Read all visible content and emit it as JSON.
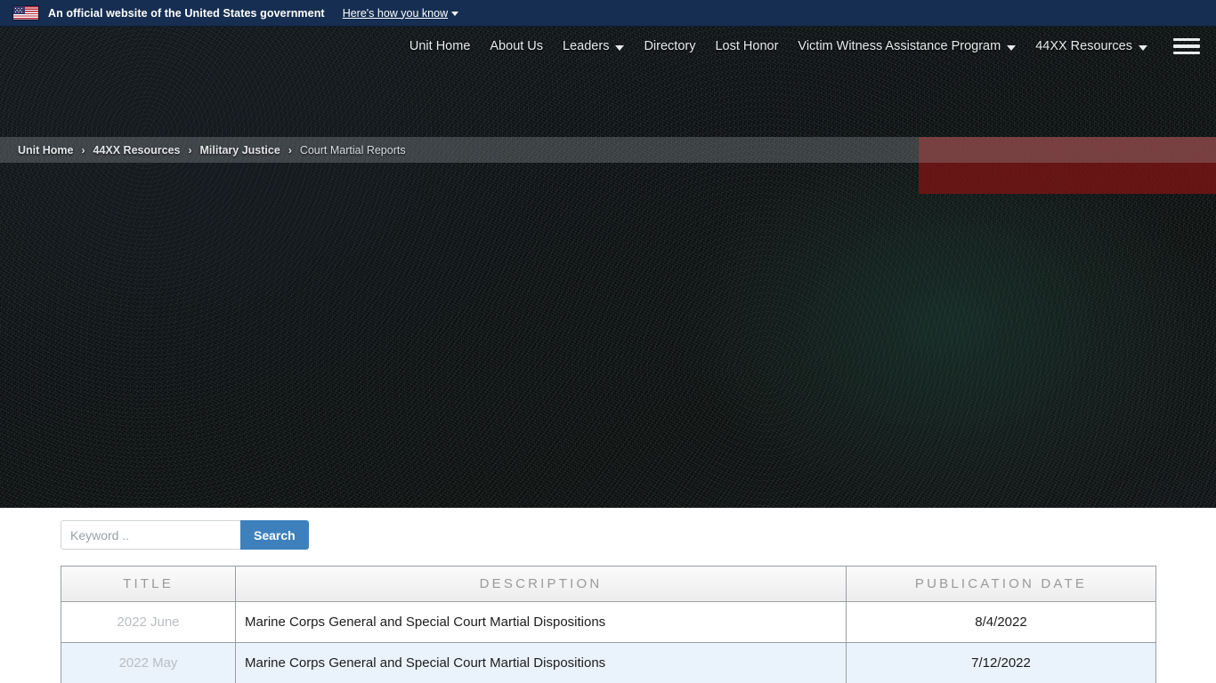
{
  "gov_banner": {
    "flag_icon": "us-flag-icon",
    "text": "An official website of the United States government",
    "link_text": "Here's how you know",
    "caret_icon": "chevron-down-icon"
  },
  "nav": {
    "menu_icon": "hamburger-menu-icon",
    "items": [
      {
        "label": "Unit Home",
        "has_caret": false
      },
      {
        "label": "About Us",
        "has_caret": false
      },
      {
        "label": "Leaders",
        "has_caret": true
      },
      {
        "label": "Directory",
        "has_caret": false
      },
      {
        "label": "Lost Honor",
        "has_caret": false
      },
      {
        "label": "Victim Witness Assistance Program",
        "has_caret": true
      },
      {
        "label": "44XX Resources",
        "has_caret": true
      }
    ]
  },
  "breadcrumb": {
    "separator": "›",
    "items": [
      {
        "label": "Unit Home",
        "current": false
      },
      {
        "label": "44XX Resources",
        "current": false
      },
      {
        "label": "Military Justice",
        "current": false
      },
      {
        "label": "Court Martial Reports",
        "current": true
      }
    ]
  },
  "search": {
    "placeholder": "Keyword ..",
    "value": "",
    "button_label": "Search"
  },
  "table": {
    "headers": [
      "TITLE",
      "DESCRIPTION",
      "PUBLICATION DATE"
    ],
    "rows": [
      {
        "title": "2022 June",
        "description": "Marine Corps General and Special Court Martial Dispositions",
        "date": "8/4/2022"
      },
      {
        "title": "2022 May",
        "description": "Marine Corps General and Special Court Martial Dispositions",
        "date": "7/12/2022"
      }
    ]
  },
  "colors": {
    "gov_banner_bg": "#162e51",
    "search_button": "#3d80bc",
    "accent_red": "#7e1313",
    "row_alt_bg": "#eaf2fb"
  }
}
